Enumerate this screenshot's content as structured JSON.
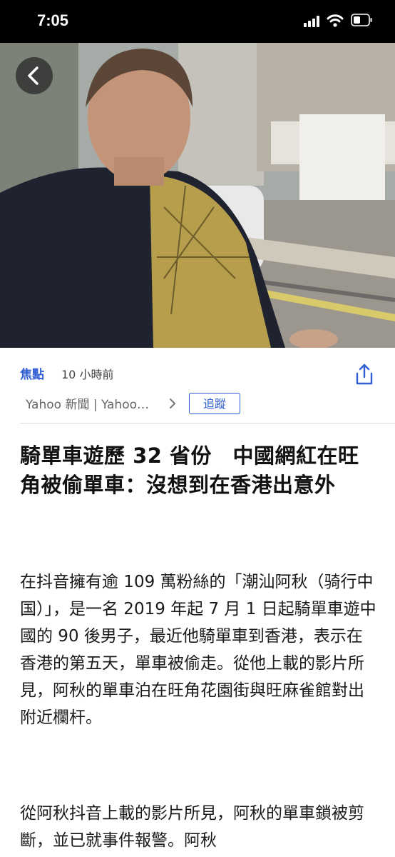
{
  "status_bar": {
    "time": "7:05"
  },
  "article": {
    "category": "焦點",
    "time_ago": "10 小時前",
    "publisher": "Yahoo 新聞 | Yahoo…",
    "follow_label": "追蹤",
    "headline": "騎單車遊歷 32 省份　中國網紅在旺角被偷單車：沒想到在香港出意外",
    "paragraphs": [
      "在抖音擁有逾 109 萬粉絲的「潮汕阿秋（骑行中国）」，是一名 2019 年起 7 月 1 日起騎單車遊中國的 90 後男子，最近他騎單車到香港，表示在香港的第五天，單車被偷走。從他上載的影片所見，阿秋的單車泊在旺角花園街與旺麻雀館對出附近欄杆。",
      "從阿秋抖音上載的影片所見，阿秋的單車鎖被剪斷，並已就事件報警。阿秋"
    ]
  },
  "colors": {
    "accent": "#2f5dd3",
    "status_bar_bg": "#000000"
  }
}
